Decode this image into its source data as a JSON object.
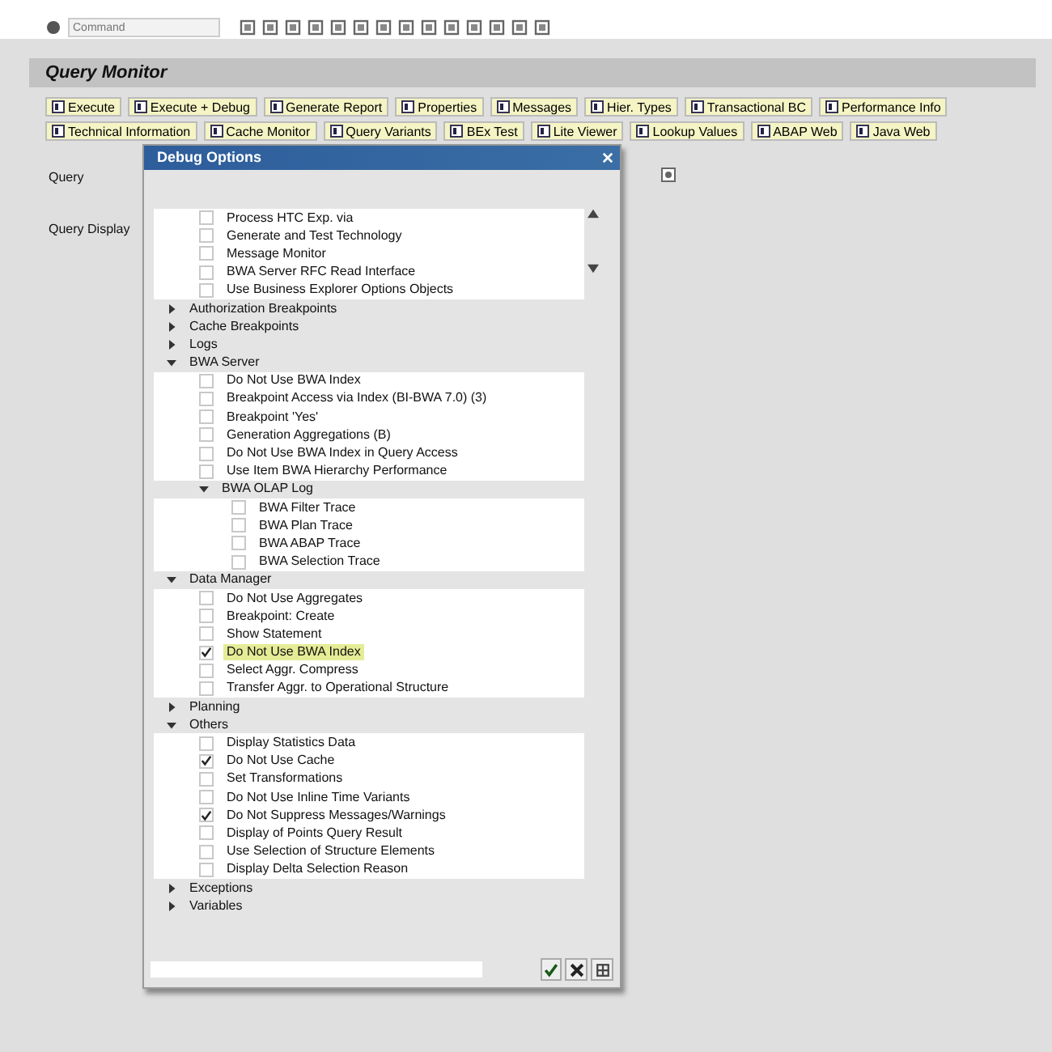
{
  "toolbar": {
    "command_placeholder": "Command"
  },
  "title": "Query Monitor",
  "actions": [
    {
      "label": "Execute"
    },
    {
      "label": "Execute + Debug"
    },
    {
      "label": "Generate Report"
    },
    {
      "label": "Properties"
    },
    {
      "label": "Messages"
    },
    {
      "label": "Hier. Types"
    },
    {
      "label": "Transactional BC"
    },
    {
      "label": "Performance Info"
    },
    {
      "label": "Technical Information"
    },
    {
      "label": "Cache Monitor"
    },
    {
      "label": "Query Variants"
    },
    {
      "label": "BEx Test"
    },
    {
      "label": "Lite Viewer"
    },
    {
      "label": "Lookup Values"
    },
    {
      "label": "ABAP Web"
    },
    {
      "label": "Java Web"
    }
  ],
  "fields": [
    {
      "label": "Query"
    },
    {
      "label": "Query Display"
    }
  ],
  "dialog": {
    "title": "Debug Options",
    "tree_continued": [
      {
        "label": "Process HTC Exp. via",
        "checked": false,
        "selected": false
      },
      {
        "label": "Generate and Test Technology",
        "checked": false,
        "selected": false
      },
      {
        "label": "Message Monitor",
        "checked": false,
        "selected": false
      },
      {
        "label": "BWA Server RFC Read Interface",
        "checked": false,
        "selected": false
      },
      {
        "label": "Use Business Explorer Options Objects",
        "checked": false,
        "selected": false
      }
    ],
    "tree": [
      {
        "label": "Authorization Breakpoints",
        "expanded": false
      },
      {
        "label": "Cache Breakpoints",
        "expanded": false
      },
      {
        "label": "Logs",
        "expanded": false
      },
      {
        "label": "BWA Server",
        "expanded": true,
        "children": [
          {
            "label": "Do Not Use BWA Index",
            "checked": false,
            "selected": false
          },
          {
            "label": "Breakpoint Access via Index (BI-BWA 7.0) (3)",
            "checked": false,
            "selected": false
          },
          {
            "label": "Breakpoint 'Yes'",
            "checked": false,
            "selected": false
          },
          {
            "label": "Generation Aggregations (B)",
            "checked": false,
            "selected": false
          },
          {
            "label": "Do Not Use BWA Index in Query Access",
            "checked": false,
            "selected": false
          },
          {
            "label": "Use Item BWA Hierarchy Performance",
            "checked": false,
            "selected": false
          },
          {
            "label": "BWA OLAP Log",
            "expanded": true,
            "children": [
              {
                "label": "BWA Filter Trace",
                "checked": false,
                "selected": false
              },
              {
                "label": "BWA Plan Trace",
                "checked": false,
                "selected": false
              },
              {
                "label": "BWA ABAP Trace",
                "checked": false,
                "selected": false
              },
              {
                "label": "BWA Selection Trace",
                "checked": false,
                "selected": false
              }
            ]
          }
        ]
      },
      {
        "label": "Data Manager",
        "expanded": true,
        "children": [
          {
            "label": "Do Not Use Aggregates",
            "checked": false,
            "selected": false
          },
          {
            "label": "Breakpoint: Create",
            "checked": false,
            "selected": false
          },
          {
            "label": "Show Statement",
            "checked": false,
            "selected": false
          },
          {
            "label": "Do Not Use BWA Index",
            "checked": true,
            "selected": true
          },
          {
            "label": "Select Aggr. Compress",
            "checked": false,
            "selected": false
          },
          {
            "label": "Transfer Aggr. to Operational Structure",
            "checked": false,
            "selected": false
          }
        ]
      },
      {
        "label": "Planning",
        "expanded": false
      },
      {
        "label": "Others",
        "expanded": true,
        "children": [
          {
            "label": "Display Statistics Data",
            "checked": false,
            "selected": false
          },
          {
            "label": "Do Not Use Cache",
            "checked": true,
            "selected": false
          },
          {
            "label": "Set Transformations",
            "checked": false,
            "selected": false
          },
          {
            "label": "Do Not Use Inline Time Variants",
            "checked": false,
            "selected": false
          },
          {
            "label": "Do Not Suppress Messages/Warnings",
            "checked": true,
            "selected": false
          },
          {
            "label": "Display of Points Query Result",
            "checked": false,
            "selected": false
          },
          {
            "label": "Use Selection of Structure Elements",
            "checked": false,
            "selected": false
          },
          {
            "label": "Display Delta Selection Reason",
            "checked": false,
            "selected": false
          }
        ]
      },
      {
        "label": "Exceptions",
        "expanded": false
      },
      {
        "label": "Variables",
        "expanded": false
      }
    ]
  }
}
